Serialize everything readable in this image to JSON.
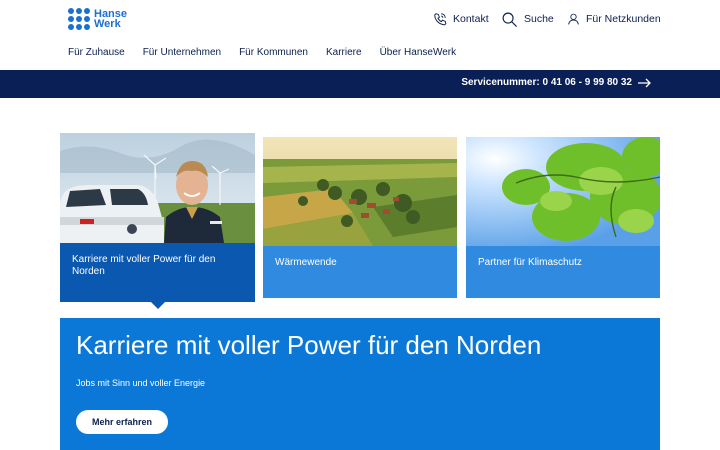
{
  "header": {
    "logo": {
      "line1": "Hanse",
      "line2": "Werk",
      "color": "#1a6fd1"
    },
    "utility": [
      {
        "label": "Kontakt",
        "icon": "phone-icon"
      },
      {
        "label": "Suche",
        "icon": "search-icon"
      },
      {
        "label": "Für Netzkunden",
        "icon": "user-icon"
      }
    ],
    "nav": [
      "Für Zuhause",
      "Für Unternehmen",
      "Für Kommunen",
      "Karriere",
      "Über HanseWerk"
    ]
  },
  "service": {
    "label": "Servicenummer: 0 41 06 - 9 99 80 32",
    "icon": "arrow-right-icon",
    "background": "#0b1f57"
  },
  "cards": [
    {
      "caption": "Karriere mit voller Power für den Norden",
      "active": true
    },
    {
      "caption": "Wärmewende",
      "active": false
    },
    {
      "caption": "Partner für Klimaschutz",
      "active": false
    }
  ],
  "hero": {
    "title": "Karriere mit voller Power für den Norden",
    "subtitle": "Jobs mit Sinn und voller Energie",
    "button_label": "Mehr erfahren",
    "background": "#0b78d8"
  }
}
